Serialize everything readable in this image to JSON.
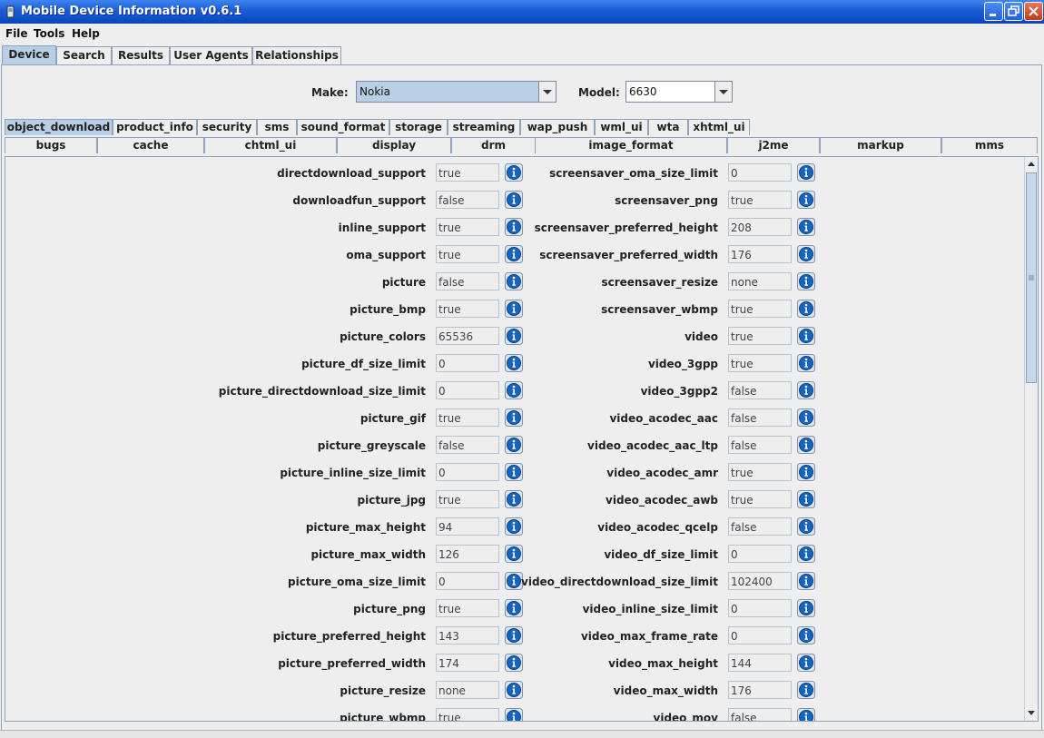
{
  "window": {
    "title": "Mobile Device Information v0.6.1"
  },
  "menu": [
    "File",
    "Tools",
    "Help"
  ],
  "main_tabs": [
    {
      "label": "Device",
      "selected": true
    },
    {
      "label": "Search",
      "selected": false
    },
    {
      "label": "Results",
      "selected": false
    },
    {
      "label": "User Agents",
      "selected": false
    },
    {
      "label": "Relationships",
      "selected": false
    }
  ],
  "selector": {
    "make_label": "Make:",
    "make_value": "Nokia",
    "model_label": "Model:",
    "model_value": "6630"
  },
  "sub_tabs_row1": [
    "object_download",
    "product_info",
    "security",
    "sms",
    "sound_format",
    "storage",
    "streaming",
    "wap_push",
    "wml_ui",
    "wta",
    "xhtml_ui"
  ],
  "sub_tabs_row2": [
    "bugs",
    "cache",
    "chtml_ui",
    "display",
    "drm",
    "image_format",
    "j2me",
    "markup",
    "mms"
  ],
  "selected_sub_tab": "object_download",
  "properties_left": [
    {
      "name": "directdownload_support",
      "value": "true"
    },
    {
      "name": "downloadfun_support",
      "value": "false"
    },
    {
      "name": "inline_support",
      "value": "true"
    },
    {
      "name": "oma_support",
      "value": "true"
    },
    {
      "name": "picture",
      "value": "false"
    },
    {
      "name": "picture_bmp",
      "value": "true"
    },
    {
      "name": "picture_colors",
      "value": "65536"
    },
    {
      "name": "picture_df_size_limit",
      "value": "0"
    },
    {
      "name": "picture_directdownload_size_limit",
      "value": "0"
    },
    {
      "name": "picture_gif",
      "value": "true"
    },
    {
      "name": "picture_greyscale",
      "value": "false"
    },
    {
      "name": "picture_inline_size_limit",
      "value": "0"
    },
    {
      "name": "picture_jpg",
      "value": "true"
    },
    {
      "name": "picture_max_height",
      "value": "94"
    },
    {
      "name": "picture_max_width",
      "value": "126"
    },
    {
      "name": "picture_oma_size_limit",
      "value": "0"
    },
    {
      "name": "picture_png",
      "value": "true"
    },
    {
      "name": "picture_preferred_height",
      "value": "143"
    },
    {
      "name": "picture_preferred_width",
      "value": "174"
    },
    {
      "name": "picture_resize",
      "value": "none"
    },
    {
      "name": "picture_wbmp",
      "value": "true"
    }
  ],
  "properties_right": [
    {
      "name": "screensaver_oma_size_limit",
      "value": "0"
    },
    {
      "name": "screensaver_png",
      "value": "true"
    },
    {
      "name": "screensaver_preferred_height",
      "value": "208"
    },
    {
      "name": "screensaver_preferred_width",
      "value": "176"
    },
    {
      "name": "screensaver_resize",
      "value": "none"
    },
    {
      "name": "screensaver_wbmp",
      "value": "true"
    },
    {
      "name": "video",
      "value": "true"
    },
    {
      "name": "video_3gpp",
      "value": "true"
    },
    {
      "name": "video_3gpp2",
      "value": "false"
    },
    {
      "name": "video_acodec_aac",
      "value": "false"
    },
    {
      "name": "video_acodec_aac_ltp",
      "value": "false"
    },
    {
      "name": "video_acodec_amr",
      "value": "true"
    },
    {
      "name": "video_acodec_awb",
      "value": "true"
    },
    {
      "name": "video_acodec_qcelp",
      "value": "false"
    },
    {
      "name": "video_df_size_limit",
      "value": "0"
    },
    {
      "name": "video_directdownload_size_limit",
      "value": "102400"
    },
    {
      "name": "video_inline_size_limit",
      "value": "0"
    },
    {
      "name": "video_max_frame_rate",
      "value": "0"
    },
    {
      "name": "video_max_height",
      "value": "144"
    },
    {
      "name": "video_max_width",
      "value": "176"
    },
    {
      "name": "video_mov",
      "value": "false"
    }
  ],
  "icons": {
    "info": "info-icon",
    "scroll_up": "arrow-up-icon",
    "scroll_down": "arrow-down-icon",
    "dropdown": "chevron-down-icon"
  },
  "colors": {
    "title_bar": "#1e5fd8",
    "selected_tab": "#b8cfe5",
    "info_button": "#1565c0"
  }
}
